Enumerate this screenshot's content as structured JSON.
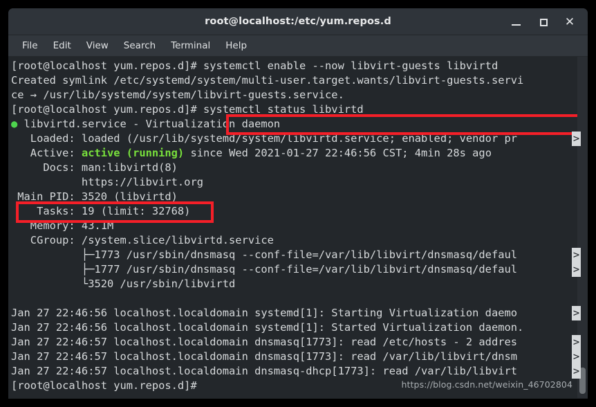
{
  "window": {
    "title": "root@localhost:/etc/yum.repos.d",
    "buttons": {
      "minimize": "–",
      "maximize": "□",
      "close": "✕"
    }
  },
  "menubar": {
    "items": [
      "File",
      "Edit",
      "View",
      "Search",
      "Terminal",
      "Help"
    ]
  },
  "terminal": {
    "prompt": "[root@localhost yum.repos.d]#",
    "cont_marker": ">",
    "lines": [
      {
        "id": "l01",
        "type": "prompt-cmd",
        "prompt": "[root@localhost yum.repos.d]# ",
        "command": "systemctl enable --now libvirt-guests libvirtd"
      },
      {
        "id": "l02",
        "type": "text",
        "text": "Created symlink /etc/systemd/system/multi-user.target.wants/libvirt-guests.servi"
      },
      {
        "id": "l03",
        "type": "text",
        "text": "ce → /usr/lib/systemd/system/libvirt-guests.service."
      },
      {
        "id": "l04",
        "type": "prompt-cmd",
        "prompt": "[root@localhost yum.repos.d]# ",
        "command": "systemctl status libvirtd"
      },
      {
        "id": "l05",
        "type": "status-head",
        "bullet": "●",
        "text": " libvirtd.service - Virtualization daemon"
      },
      {
        "id": "l06",
        "type": "text",
        "text": "   Loaded: loaded (/usr/lib/systemd/system/libvirtd.service; enabled; vendor pr",
        "cont": true
      },
      {
        "id": "l07",
        "type": "active",
        "label": "   Active: ",
        "state": "active (running)",
        "rest": " since Wed 2021-01-27 22:46:56 CST; 4min 28s ago"
      },
      {
        "id": "l08",
        "type": "text",
        "text": "     Docs: man:libvirtd(8)"
      },
      {
        "id": "l09",
        "type": "text",
        "text": "           https://libvirt.org"
      },
      {
        "id": "l10",
        "type": "text",
        "text": " Main PID: 3520 (libvirtd)"
      },
      {
        "id": "l11",
        "type": "text",
        "text": "    Tasks: 19 (limit: 32768)"
      },
      {
        "id": "l12",
        "type": "text",
        "text": "   Memory: 43.1M"
      },
      {
        "id": "l13",
        "type": "text",
        "text": "   CGroup: /system.slice/libvirtd.service"
      },
      {
        "id": "l14",
        "type": "text",
        "text": "           ├─1773 /usr/sbin/dnsmasq --conf-file=/var/lib/libvirt/dnsmasq/defaul",
        "cont": true
      },
      {
        "id": "l15",
        "type": "text",
        "text": "           ├─1777 /usr/sbin/dnsmasq --conf-file=/var/lib/libvirt/dnsmasq/defaul",
        "cont": true
      },
      {
        "id": "l16",
        "type": "text",
        "text": "           └3520 /usr/sbin/libvirtd"
      },
      {
        "id": "l17",
        "type": "blank",
        "text": ""
      },
      {
        "id": "l18",
        "type": "text",
        "text": "Jan 27 22:46:56 localhost.localdomain systemd[1]: Starting Virtualization daemo",
        "cont": true
      },
      {
        "id": "l19",
        "type": "text",
        "text": "Jan 27 22:46:56 localhost.localdomain systemd[1]: Started Virtualization daemon."
      },
      {
        "id": "l20",
        "type": "text",
        "text": "Jan 27 22:46:57 localhost.localdomain dnsmasq[1773]: read /etc/hosts - 2 addres",
        "cont": true
      },
      {
        "id": "l21",
        "type": "text",
        "text": "Jan 27 22:46:57 localhost.localdomain dnsmasq[1773]: read /var/lib/libvirt/dnsm",
        "cont": true
      },
      {
        "id": "l22",
        "type": "text",
        "text": "Jan 27 22:46:57 localhost.localdomain dnsmasq-dhcp[1773]: read /var/lib/libvirt",
        "cont": true
      },
      {
        "id": "l23",
        "type": "text",
        "text": "[root@localhost yum.repos.d]#"
      }
    ]
  },
  "annotations": {
    "box_color": "#f41f28",
    "boxes": [
      {
        "name": "enable-command-highlight",
        "target": "systemctl enable --now libvirt-guests libvirtd"
      },
      {
        "name": "active-running-highlight",
        "target": "Active: active (running)"
      }
    ]
  },
  "watermark": {
    "text": "https://blog.csdn.net/weixin_46702804"
  }
}
